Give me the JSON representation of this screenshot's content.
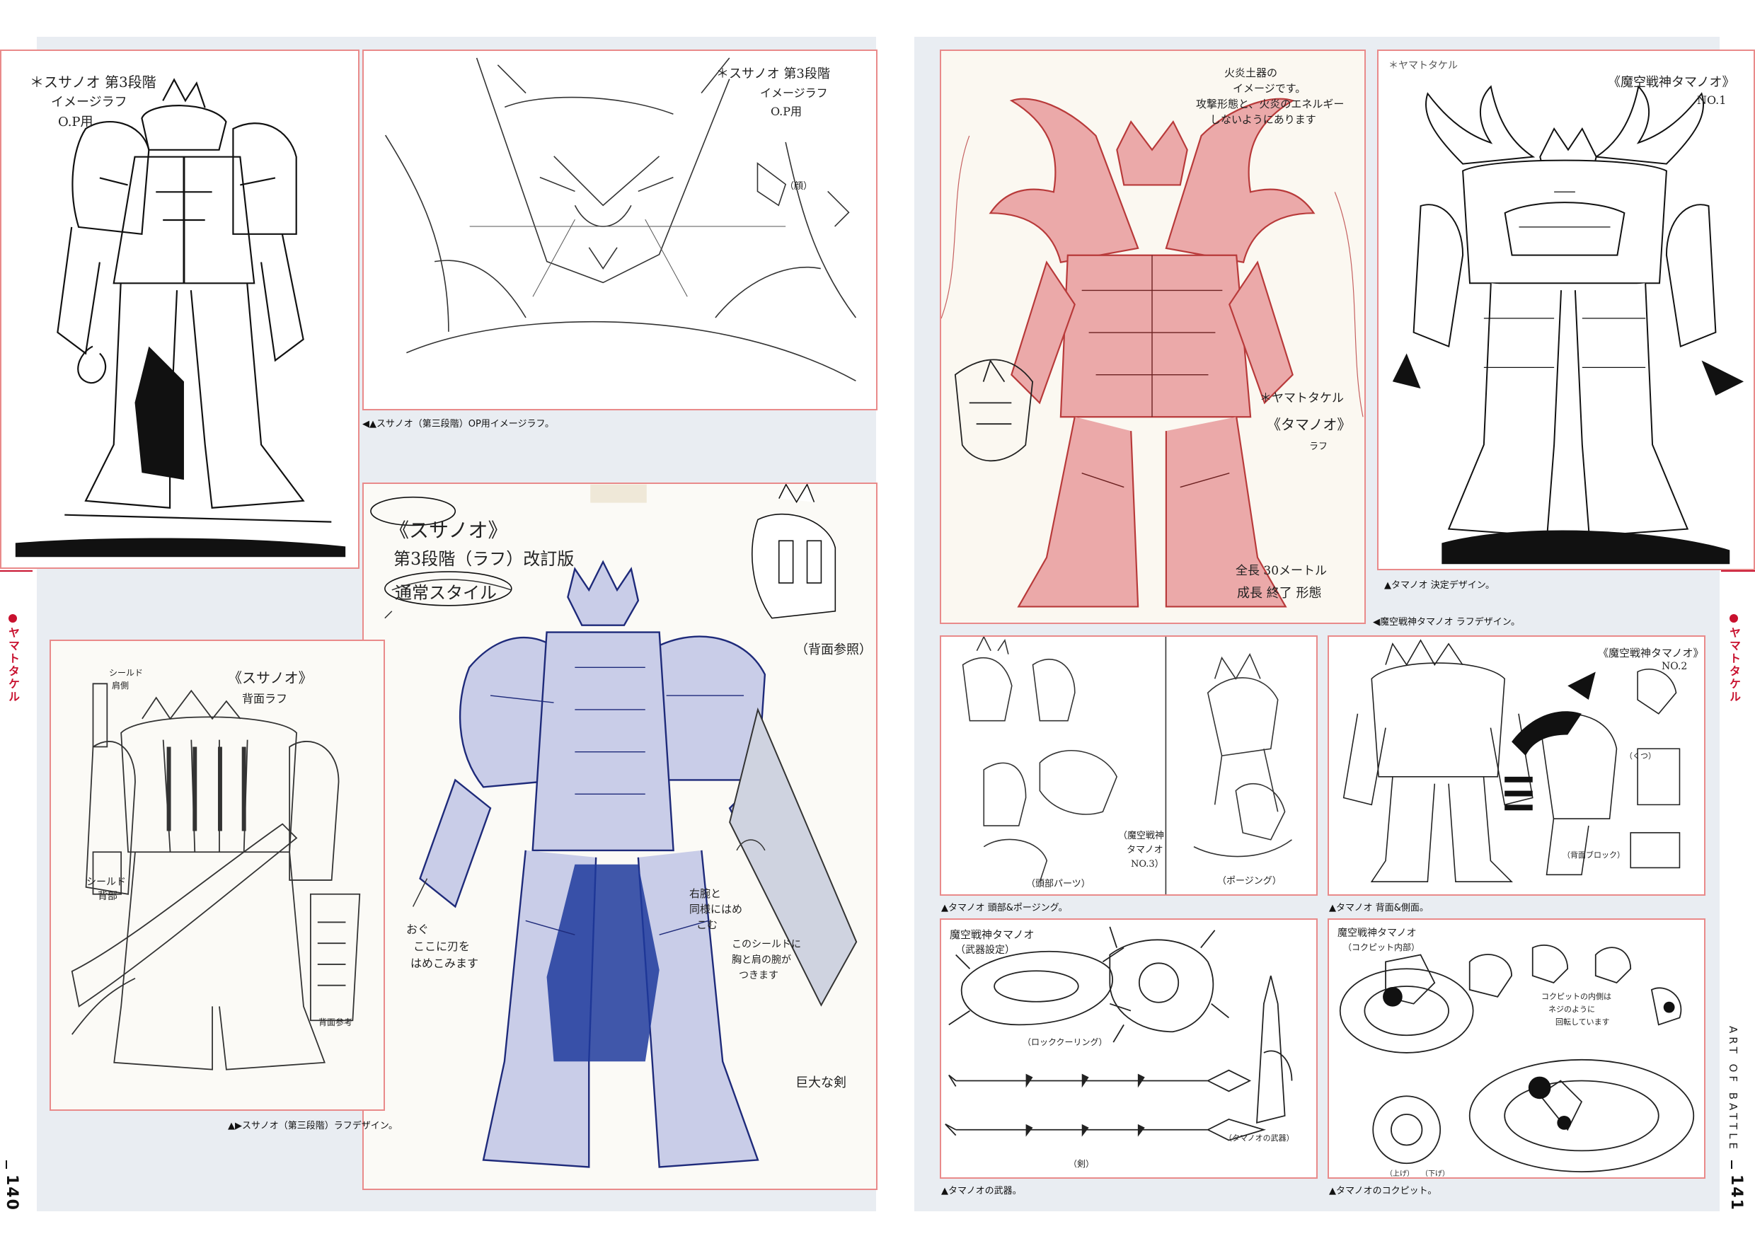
{
  "pages": {
    "left": {
      "number": "140",
      "side_label": "ヤマトタケル"
    },
    "right": {
      "number": "141",
      "side_label": "ヤマトタケル",
      "running_title": "ART OF BATTLE"
    }
  },
  "panels": {
    "p1": {
      "notes": [
        "＊スサノオ 第3段階",
        "イメージラフ",
        "O.P用"
      ]
    },
    "p2": {
      "notes": [
        "＊スサノオ 第3段階",
        "イメージラフ",
        "O.P用",
        "（顔）"
      ]
    },
    "p3": {
      "notes": [
        "《スサノオ》",
        "第3段階（ラフ）改訂版",
        "通常スタイル",
        "（背面参照）",
        "おぐ",
        "ここに刃を",
        "はめこみます",
        "右腕と",
        "同様にはめ",
        "こむ",
        "このシールドに",
        "胸と肩の腕が",
        "つきます",
        "巨大な剣"
      ]
    },
    "p4": {
      "notes": [
        "《スサノオ》",
        "背面ラフ",
        "シールド",
        "肩側",
        "シールド",
        "背部",
        "背面参考"
      ]
    },
    "p5": {
      "notes": [
        "火炎土器の",
        "イメージです。",
        "攻撃形態と、火炎のエネルギー",
        "しないようにあります",
        "＊ヤマトタケル",
        "《タマノオ》",
        "ラフ",
        "全長 30メートル",
        "成長 終了 形態"
      ]
    },
    "p6": {
      "notes": [
        "＊ヤマトタケル",
        "《魔空戦神タマノオ》",
        "NO.1"
      ]
    },
    "p7": {
      "notes": [
        "（頭部パーツ）",
        "（魔空戦神",
        "タマノオ",
        "NO.3）",
        "（ポージング）"
      ]
    },
    "p8": {
      "notes": [
        "《魔空戦神タマノオ》",
        "NO.2",
        "（くつ）",
        "（背面ブロック）"
      ]
    },
    "p9": {
      "notes": [
        "魔空戦神タマノオ",
        "（武器設定）",
        "（ロッククーリング）",
        "（剣）",
        "（タマノオの武器）"
      ]
    },
    "p10": {
      "notes": [
        "魔空戦神タマノオ",
        "（コクピット内部）",
        "コクピットの内側は",
        "ネジのように",
        "回転しています",
        "（上げ）",
        "（下げ）"
      ]
    }
  },
  "captions": {
    "p2": "◀▲スサノオ（第三段階）OP用イメージラフ。",
    "p4": "▲▶スサノオ（第三段階）ラフデザイン。",
    "p5": "◀魔空戦神タマノオ ラフデザイン。",
    "p6": "▲タマノオ 決定デザイン。",
    "p7": "▲タマノオ 頭部&ポージング。",
    "p8": "▲タマノオ 背面&側面。",
    "p9": "▲タマノオの武器。",
    "p10": "▲タマノオのコクピット。"
  },
  "colors": {
    "frame": "#e98a8a",
    "accent_red": "#c8102e",
    "background": "#e9edf2"
  }
}
